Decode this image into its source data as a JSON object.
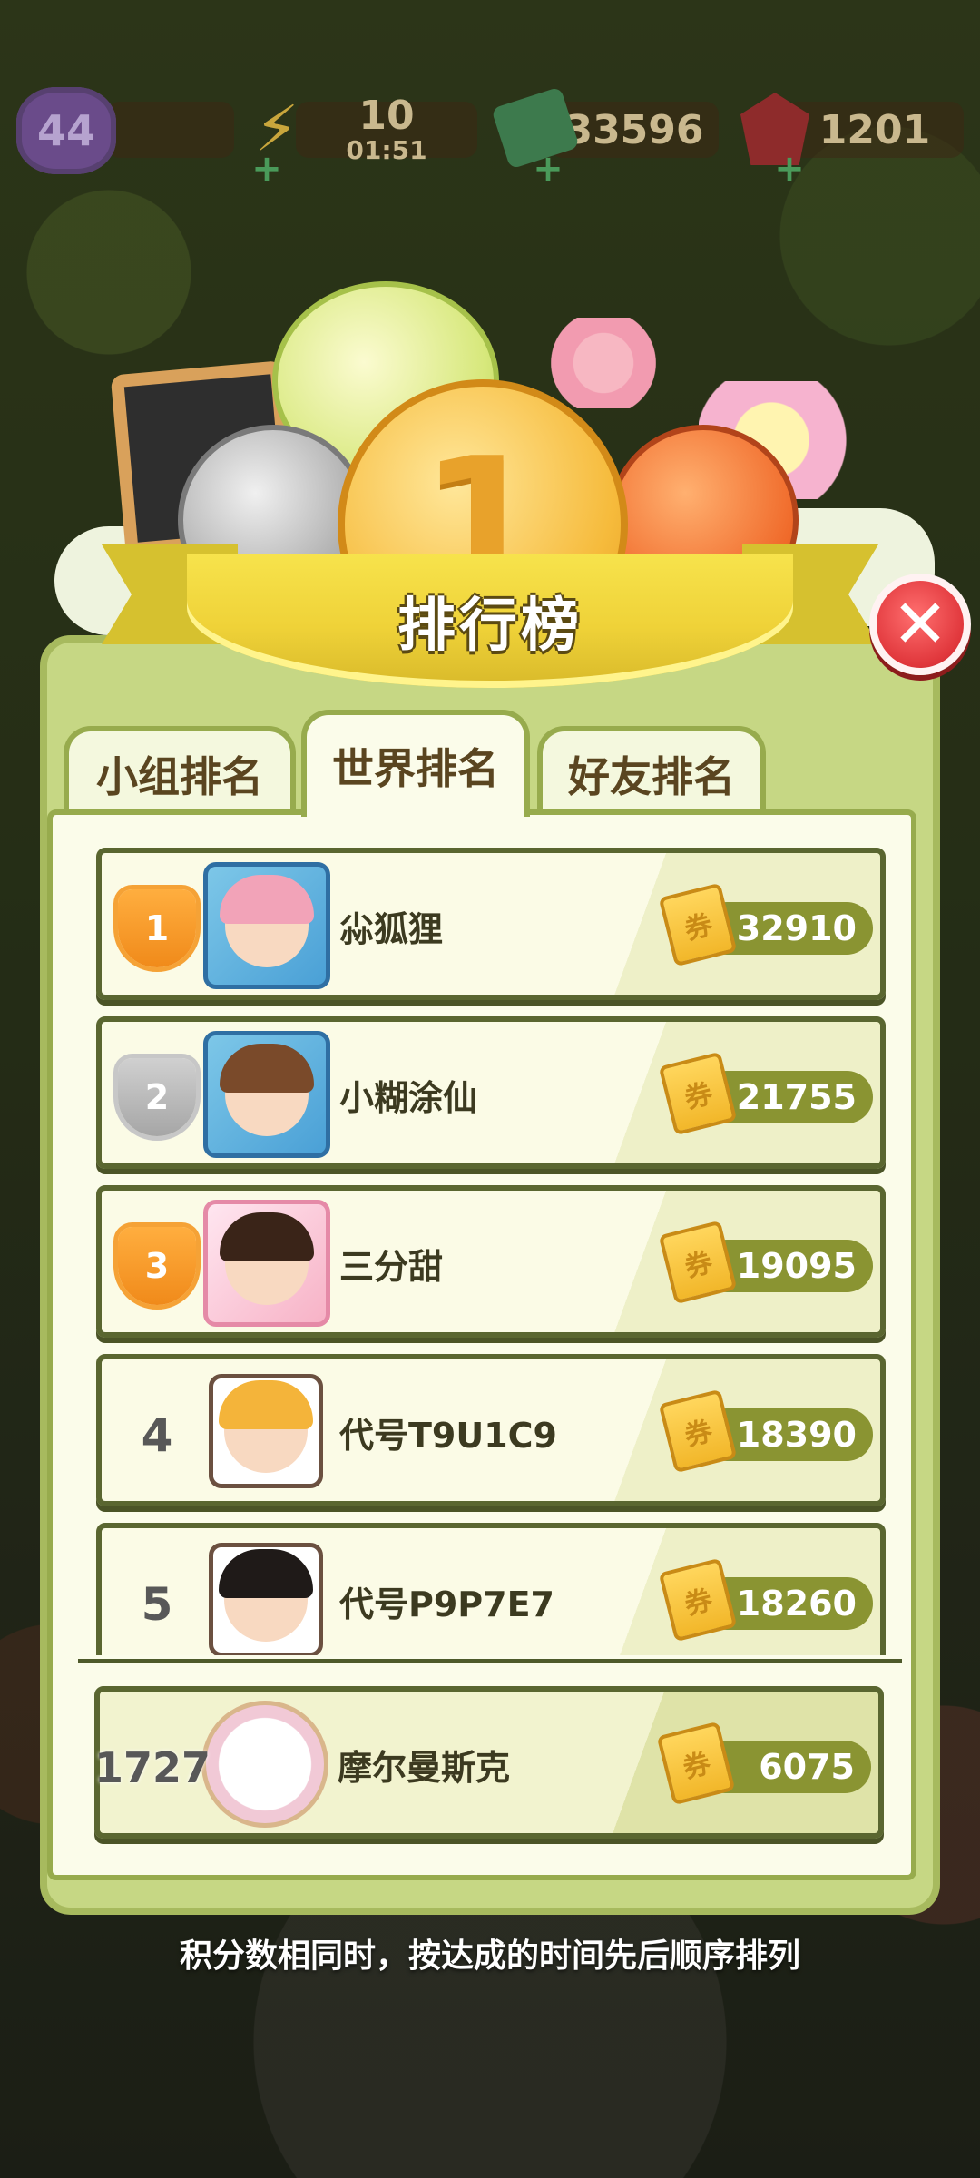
{
  "status": {
    "level": "44",
    "energy": "10",
    "energy_timer": "01:51",
    "cash": "33596",
    "gems": "1201"
  },
  "header": {
    "title": "排行榜",
    "gold_medal_number": "1"
  },
  "tabs": [
    {
      "label": "小组排名",
      "active": false
    },
    {
      "label": "世界排名",
      "active": true
    },
    {
      "label": "好友排名",
      "active": false
    }
  ],
  "leaderboard": [
    {
      "rank": "1",
      "name": "尛狐狸",
      "score": "32910",
      "trophy": "gold"
    },
    {
      "rank": "2",
      "name": "小糊涂仙",
      "score": "21755",
      "trophy": "silver"
    },
    {
      "rank": "3",
      "name": "三分甜",
      "score": "19095",
      "trophy": "bronze"
    },
    {
      "rank": "4",
      "name": "代号T9U1C9",
      "score": "18390",
      "trophy": "none"
    },
    {
      "rank": "5",
      "name": "代号P9P7E7",
      "score": "18260",
      "trophy": "none"
    }
  ],
  "my_entry": {
    "rank": "1727",
    "name": "摩尔曼斯克",
    "score": "6075"
  },
  "footnote": "积分数相同时，按达成的时间先后顺序排列",
  "colors": {
    "panel": "#c6d784",
    "ribbon": "#efd238",
    "score_pill": "#8a9432",
    "close": "#e0363b"
  }
}
